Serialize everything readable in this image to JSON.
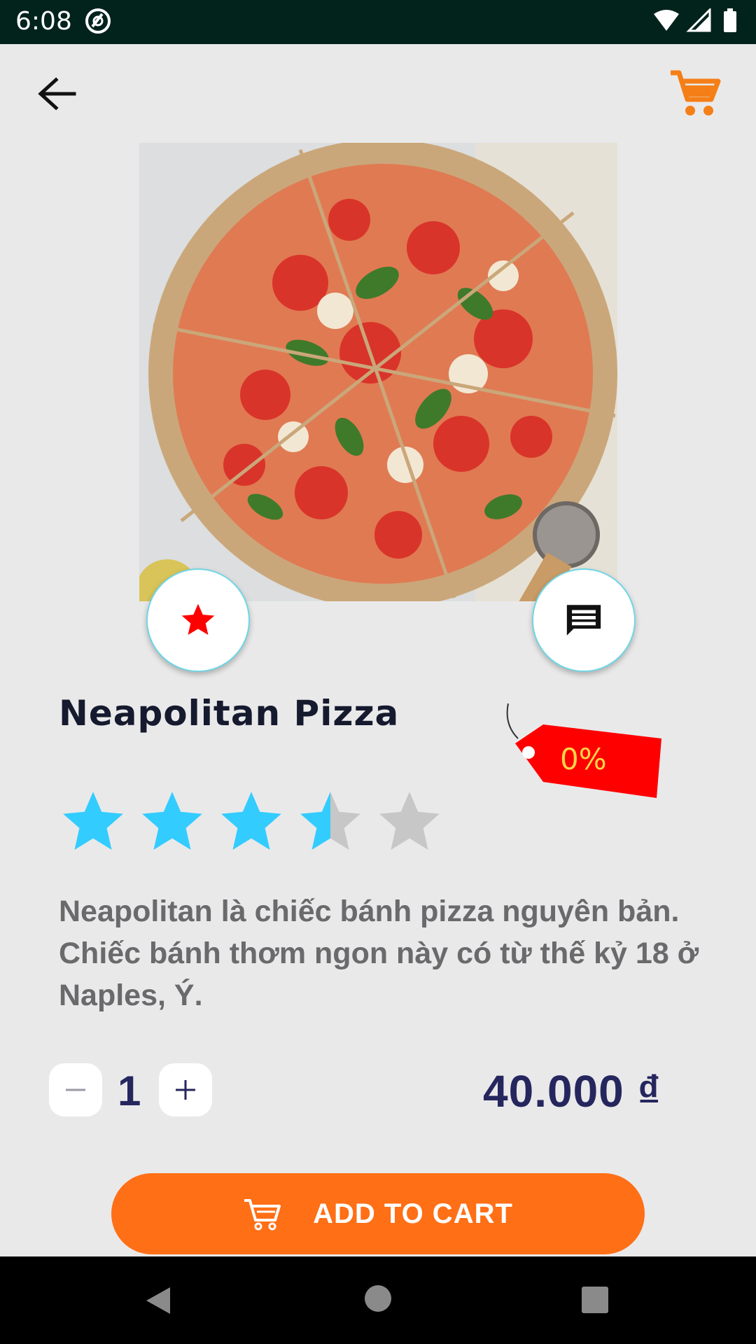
{
  "status_bar": {
    "time": "6:08"
  },
  "header": {
    "back_icon": "arrow-left-icon",
    "cart_icon": "shopping-cart-icon",
    "cart_color": "#f57f17"
  },
  "product": {
    "image_alt": "Neapolitan Pizza photo",
    "name": "Neapolitan Pizza",
    "discount": "0%",
    "rating": 3.5,
    "rating_max": 5,
    "description": "Neapolitan là chiếc bánh pizza nguyên bản. Chiếc bánh thơm ngon này có từ thế kỷ 18 ở Naples, Ý.",
    "quantity": "1",
    "price": "40.000 ₫"
  },
  "actions": {
    "favorite_icon": "star-icon",
    "comment_icon": "comment-icon",
    "add_to_cart_label": "ADD TO CART"
  },
  "colors": {
    "accent": "#ff6f16",
    "star_filled": "#33ccff",
    "star_empty": "#c7c7c7",
    "price": "#26265e",
    "tag": "#ff0000"
  }
}
